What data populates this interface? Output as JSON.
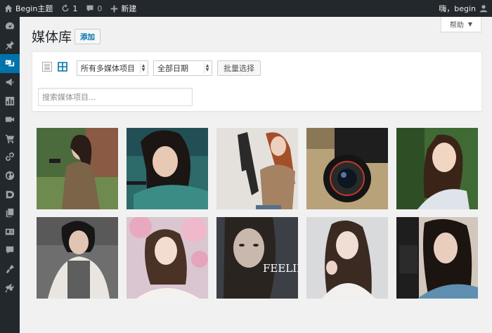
{
  "adminbar": {
    "site_name": "Begin主题",
    "updates_count": "1",
    "comments_count": "0",
    "new_label": "新建",
    "greeting": "嗨，begin"
  },
  "help": {
    "label": "帮助",
    "caret": "▼"
  },
  "page": {
    "title": "媒体库",
    "add_label": "添加"
  },
  "filters": {
    "type_selected": "所有多媒体项目",
    "date_selected": "全部日期",
    "bulk_select_label": "批量选择",
    "search_placeholder": "搜索媒体项目..."
  },
  "sidemenu": {
    "items": [
      "dashboard-icon",
      "pin-icon",
      "media-icon",
      "megaphone-icon",
      "chart-icon",
      "video-icon",
      "cart-icon",
      "link-icon",
      "globe-icon",
      "shield-icon",
      "pages-icon",
      "id-card-icon",
      "comment-icon",
      "appearance-icon",
      "plugins-icon"
    ],
    "active": "media-icon"
  },
  "media": {
    "items": [
      {
        "name": "media-item-1",
        "caption": ""
      },
      {
        "name": "media-item-2",
        "caption": ""
      },
      {
        "name": "media-item-3",
        "caption": ""
      },
      {
        "name": "media-item-4",
        "caption": ""
      },
      {
        "name": "media-item-5",
        "caption": ""
      },
      {
        "name": "media-item-6",
        "caption": ""
      },
      {
        "name": "media-item-7",
        "caption": ""
      },
      {
        "name": "media-item-8",
        "caption": "FEELIN"
      },
      {
        "name": "media-item-9",
        "caption": ""
      },
      {
        "name": "media-item-10",
        "caption": ""
      }
    ]
  },
  "colors": {
    "adminbar_bg": "#23282d",
    "active_menu": "#0073aa",
    "page_bg": "#f1f1f1",
    "link_blue": "#0073aa"
  }
}
